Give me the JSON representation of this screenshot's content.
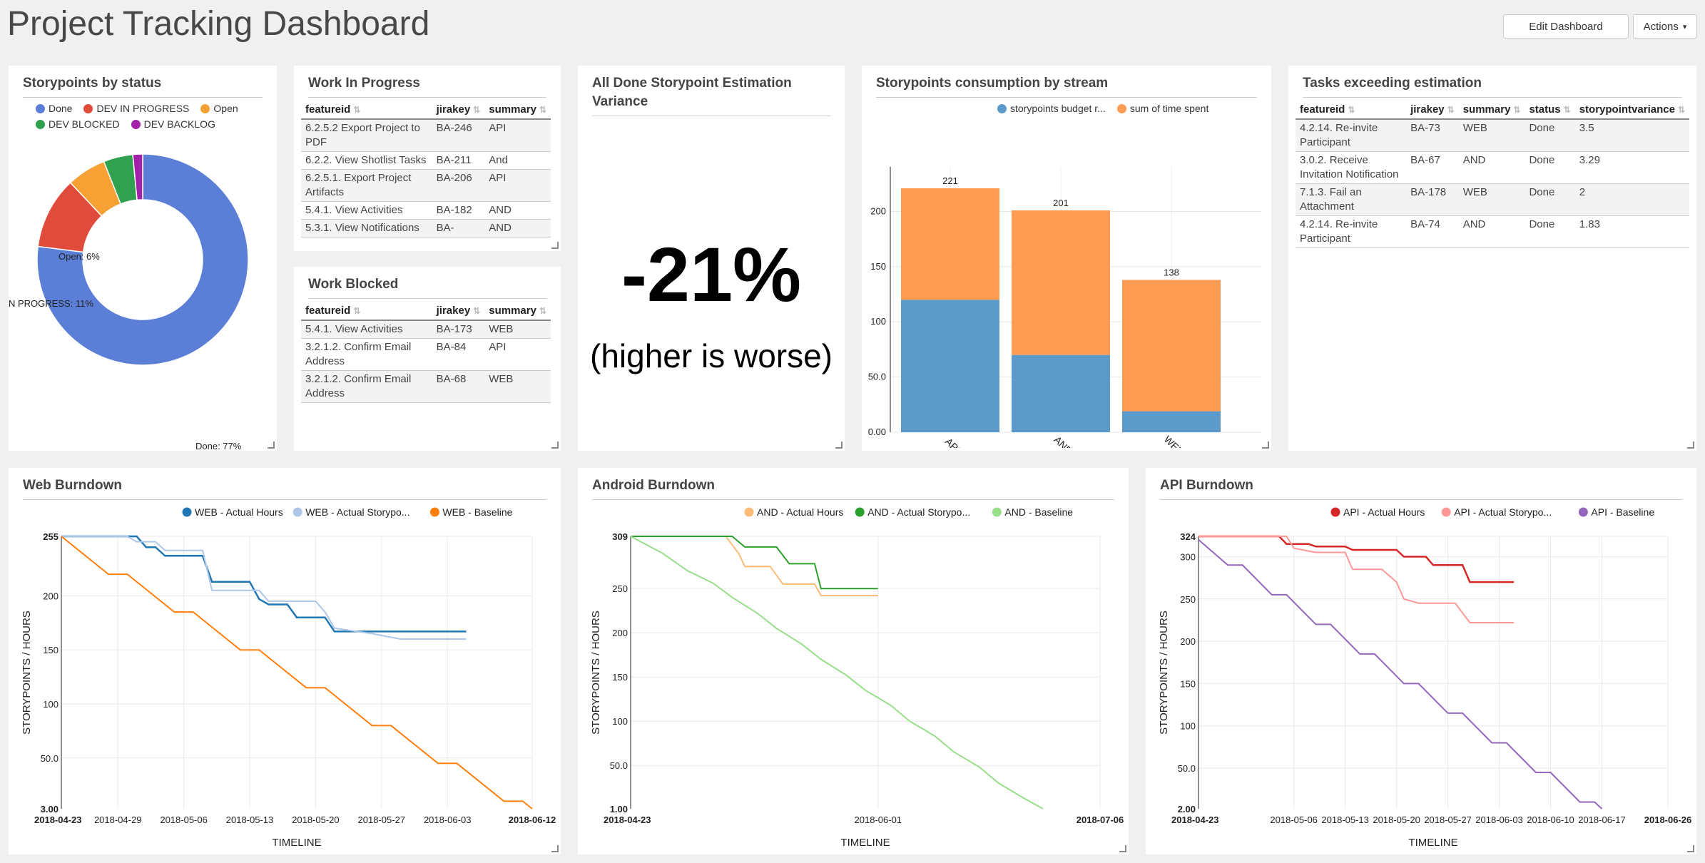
{
  "header": {
    "title": "Project Tracking Dashboard",
    "edit_label": "Edit Dashboard",
    "actions_label": "Actions"
  },
  "status_panel": {
    "title": "Storypoints by status",
    "legend": [
      {
        "label": "Done",
        "color": "#5b7fd6"
      },
      {
        "label": "DEV IN PROGRESS",
        "color": "#e04b3b"
      },
      {
        "label": "Open",
        "color": "#f7a033"
      },
      {
        "label": "DEV BLOCKED",
        "color": "#30a14e"
      },
      {
        "label": "DEV BACKLOG",
        "color": "#a321a8"
      }
    ],
    "slice_labels": [
      "Done: 77%",
      "N PROGRESS: 11%",
      "Open: 6%"
    ]
  },
  "wip_panel": {
    "title": "Work In Progress",
    "columns": [
      "featureid",
      "jirakey",
      "summary"
    ],
    "rows": [
      [
        "6.2.5.2 Export Project to PDF",
        "BA-246",
        "API"
      ],
      [
        "6.2.2. View Shotlist Tasks",
        "BA-211",
        "And"
      ],
      [
        "6.2.5.1. Export Project Artifacts",
        "BA-206",
        "API"
      ],
      [
        "5.4.1. View Activities",
        "BA-182",
        "AND"
      ],
      [
        "5.3.1. View Notifications",
        "BA-",
        "AND"
      ]
    ]
  },
  "blocked_panel": {
    "title": "Work Blocked",
    "columns": [
      "featureid",
      "jirakey",
      "summary"
    ],
    "rows": [
      [
        "5.4.1. View Activities",
        "BA-173",
        "WEB"
      ],
      [
        "3.2.1.2. Confirm Email Address",
        "BA-84",
        "API"
      ],
      [
        "3.2.1.2. Confirm Email Address",
        "BA-68",
        "WEB"
      ]
    ]
  },
  "variance_panel": {
    "title": "All Done Storypoint Estimation Variance",
    "value": "-21%",
    "note": "(higher is worse)"
  },
  "consumption_panel": {
    "title": "Storypoints consumption by stream",
    "chart_data": {
      "type": "bar",
      "stacked": true,
      "categories": [
        "API",
        "AND",
        "WEB"
      ],
      "series": [
        {
          "name": "storypoints budget r...",
          "values": [
            120,
            70,
            19
          ],
          "color": "#5b9ac9"
        },
        {
          "name": "sum of time spent",
          "values": [
            101,
            131,
            119
          ],
          "color": "#fd9c52"
        }
      ],
      "totals": [
        "221",
        "201",
        "138"
      ],
      "ylim": [
        0,
        221
      ],
      "yticks": [
        "0.00",
        "50.0",
        "100",
        "150",
        "200"
      ]
    }
  },
  "exceed_panel": {
    "title": "Tasks exceeding estimation",
    "columns": [
      "featureid",
      "jirakey",
      "summary",
      "status",
      "storypointvariance"
    ],
    "rows": [
      [
        "4.2.14. Re-invite Participant",
        "BA-73",
        "WEB",
        "Done",
        "3.5"
      ],
      [
        "3.0.2. Receive Invitation Notification",
        "BA-67",
        "AND",
        "Done",
        "3.29"
      ],
      [
        "7.1.3. Fail an Attachment",
        "BA-178",
        "WEB",
        "Done",
        "2"
      ],
      [
        "4.2.14. Re-invite Participant",
        "BA-74",
        "AND",
        "Done",
        "1.83"
      ]
    ]
  },
  "web_burndown": {
    "title": "Web Burndown",
    "ylabel": "STORYPOINTS / HOURS",
    "xlabel": "TIMELINE",
    "chart_data": {
      "type": "line",
      "xlim": [
        "2018-04-23",
        "2018-06-12"
      ],
      "ylim": [
        3,
        255
      ],
      "xticks": [
        "2018-04-23",
        "2018-04-29",
        "2018-05-06",
        "2018-05-13",
        "2018-05-20",
        "2018-05-27",
        "2018-06-03",
        "2018-06-12"
      ],
      "yticks": [
        "3.00",
        "50.0",
        "100",
        "150",
        "200",
        "255"
      ],
      "series": [
        {
          "name": "WEB - Actual Hours",
          "color": "#1f77b4",
          "width": 2.5,
          "points": [
            [
              "2018-04-23",
              255
            ],
            [
              "2018-05-01",
              255
            ],
            [
              "2018-05-02",
              245
            ],
            [
              "2018-05-03",
              245
            ],
            [
              "2018-05-04",
              237
            ],
            [
              "2018-05-08",
              237
            ],
            [
              "2018-05-09",
              213
            ],
            [
              "2018-05-13",
              213
            ],
            [
              "2018-05-14",
              197
            ],
            [
              "2018-05-15",
              192
            ],
            [
              "2018-05-17",
              192
            ],
            [
              "2018-05-18",
              180
            ],
            [
              "2018-05-21",
              180
            ],
            [
              "2018-05-22",
              167
            ],
            [
              "2018-06-05",
              167
            ]
          ]
        },
        {
          "name": "WEB - Actual Storypo...",
          "color": "#aec7e8",
          "width": 2,
          "points": [
            [
              "2018-04-23",
              255
            ],
            [
              "2018-04-30",
              255
            ],
            [
              "2018-05-01",
              250
            ],
            [
              "2018-05-03",
              250
            ],
            [
              "2018-05-04",
              242
            ],
            [
              "2018-05-08",
              242
            ],
            [
              "2018-05-09",
              205
            ],
            [
              "2018-05-14",
              205
            ],
            [
              "2018-05-15",
              195
            ],
            [
              "2018-05-20",
              195
            ],
            [
              "2018-05-21",
              185
            ],
            [
              "2018-05-22",
              170
            ],
            [
              "2018-05-26",
              165
            ],
            [
              "2018-05-29",
              160
            ],
            [
              "2018-06-05",
              160
            ]
          ]
        },
        {
          "name": "WEB - Baseline",
          "color": "#ff7f0e",
          "width": 2,
          "points": [
            [
              "2018-04-23",
              255
            ],
            [
              "2018-04-28",
              220
            ],
            [
              "2018-04-30",
              220
            ],
            [
              "2018-05-05",
              185
            ],
            [
              "2018-05-07",
              185
            ],
            [
              "2018-05-12",
              150
            ],
            [
              "2018-05-14",
              150
            ],
            [
              "2018-05-19",
              115
            ],
            [
              "2018-05-21",
              115
            ],
            [
              "2018-05-26",
              80
            ],
            [
              "2018-05-28",
              80
            ],
            [
              "2018-06-02",
              45
            ],
            [
              "2018-06-04",
              45
            ],
            [
              "2018-06-09",
              10
            ],
            [
              "2018-06-11",
              10
            ],
            [
              "2018-06-12",
              3
            ]
          ]
        }
      ]
    }
  },
  "android_burndown": {
    "title": "Android Burndown",
    "ylabel": "STORYPOINTS / HOURS",
    "xlabel": "TIMELINE",
    "chart_data": {
      "type": "line",
      "xlim": [
        "2018-04-23",
        "2018-07-06"
      ],
      "ylim": [
        1,
        309
      ],
      "xticks": [
        "2018-04-23",
        "2018-06-01",
        "2018-07-06"
      ],
      "yticks": [
        "1.00",
        "50.0",
        "100",
        "150",
        "200",
        "250",
        "309"
      ],
      "series": [
        {
          "name": "AND - Actual Hours",
          "color": "#ffbb78",
          "width": 2,
          "points": [
            [
              "2018-04-23",
              309
            ],
            [
              "2018-05-08",
              309
            ],
            [
              "2018-05-10",
              290
            ],
            [
              "2018-05-11",
              275
            ],
            [
              "2018-05-15",
              275
            ],
            [
              "2018-05-17",
              255
            ],
            [
              "2018-05-22",
              255
            ],
            [
              "2018-05-23",
              242
            ],
            [
              "2018-06-01",
              242
            ]
          ]
        },
        {
          "name": "AND - Actual Storypo...",
          "color": "#2ca02c",
          "width": 2,
          "points": [
            [
              "2018-04-23",
              309
            ],
            [
              "2018-05-09",
              309
            ],
            [
              "2018-05-11",
              297
            ],
            [
              "2018-05-16",
              297
            ],
            [
              "2018-05-18",
              278
            ],
            [
              "2018-05-22",
              278
            ],
            [
              "2018-05-23",
              250
            ],
            [
              "2018-06-01",
              250
            ]
          ]
        },
        {
          "name": "AND - Baseline",
          "color": "#98df8a",
          "width": 2,
          "points": [
            [
              "2018-04-23",
              309
            ],
            [
              "2018-04-28",
              290
            ],
            [
              "2018-05-02",
              270
            ],
            [
              "2018-05-06",
              256
            ],
            [
              "2018-05-09",
              240
            ],
            [
              "2018-05-13",
              222
            ],
            [
              "2018-05-16",
              205
            ],
            [
              "2018-05-20",
              187
            ],
            [
              "2018-05-23",
              170
            ],
            [
              "2018-05-27",
              152
            ],
            [
              "2018-05-30",
              135
            ],
            [
              "2018-06-03",
              118
            ],
            [
              "2018-06-06",
              100
            ],
            [
              "2018-06-10",
              83
            ],
            [
              "2018-06-13",
              65
            ],
            [
              "2018-06-17",
              48
            ],
            [
              "2018-06-20",
              30
            ],
            [
              "2018-06-24",
              13
            ],
            [
              "2018-06-27",
              1
            ]
          ]
        }
      ]
    }
  },
  "api_burndown": {
    "title": "API Burndown",
    "ylabel": "STORYPOINTS / HOURS",
    "xlabel": "TIMELINE",
    "chart_data": {
      "type": "line",
      "xlim": [
        "2018-04-23",
        "2018-06-26"
      ],
      "ylim": [
        2,
        324
      ],
      "xticks": [
        "2018-04-23",
        "2018-05-06",
        "2018-05-13",
        "2018-05-20",
        "2018-05-27",
        "2018-06-03",
        "2018-06-10",
        "2018-06-17",
        "2018-06-26"
      ],
      "yticks": [
        "2.00",
        "50.0",
        "100",
        "150",
        "200",
        "250",
        "300",
        "324"
      ],
      "series": [
        {
          "name": "API - Actual Hours",
          "color": "#d62728",
          "width": 2.5,
          "points": [
            [
              "2018-04-23",
              324
            ],
            [
              "2018-05-04",
              324
            ],
            [
              "2018-05-05",
              315
            ],
            [
              "2018-05-08",
              315
            ],
            [
              "2018-05-09",
              312
            ],
            [
              "2018-05-13",
              312
            ],
            [
              "2018-05-14",
              308
            ],
            [
              "2018-05-20",
              308
            ],
            [
              "2018-05-21",
              300
            ],
            [
              "2018-05-24",
              300
            ],
            [
              "2018-05-25",
              290
            ],
            [
              "2018-05-29",
              290
            ],
            [
              "2018-05-30",
              270
            ],
            [
              "2018-06-05",
              270
            ]
          ]
        },
        {
          "name": "API - Actual Storypo...",
          "color": "#ff9896",
          "width": 2,
          "points": [
            [
              "2018-04-23",
              324
            ],
            [
              "2018-05-05",
              324
            ],
            [
              "2018-05-06",
              310
            ],
            [
              "2018-05-09",
              305
            ],
            [
              "2018-05-13",
              305
            ],
            [
              "2018-05-14",
              285
            ],
            [
              "2018-05-18",
              285
            ],
            [
              "2018-05-20",
              270
            ],
            [
              "2018-05-21",
              250
            ],
            [
              "2018-05-23",
              245
            ],
            [
              "2018-05-28",
              245
            ],
            [
              "2018-05-30",
              222
            ],
            [
              "2018-06-05",
              222
            ]
          ]
        },
        {
          "name": "API - Baseline",
          "color": "#9467bd",
          "width": 2,
          "points": [
            [
              "2018-04-23",
              320
            ],
            [
              "2018-04-27",
              290
            ],
            [
              "2018-04-29",
              290
            ],
            [
              "2018-05-03",
              255
            ],
            [
              "2018-05-05",
              255
            ],
            [
              "2018-05-09",
              220
            ],
            [
              "2018-05-11",
              220
            ],
            [
              "2018-05-15",
              185
            ],
            [
              "2018-05-17",
              185
            ],
            [
              "2018-05-21",
              150
            ],
            [
              "2018-05-23",
              150
            ],
            [
              "2018-05-27",
              115
            ],
            [
              "2018-05-29",
              115
            ],
            [
              "2018-06-02",
              80
            ],
            [
              "2018-06-04",
              80
            ],
            [
              "2018-06-08",
              45
            ],
            [
              "2018-06-10",
              45
            ],
            [
              "2018-06-14",
              10
            ],
            [
              "2018-06-16",
              10
            ],
            [
              "2018-06-17",
              2
            ]
          ]
        }
      ]
    }
  }
}
